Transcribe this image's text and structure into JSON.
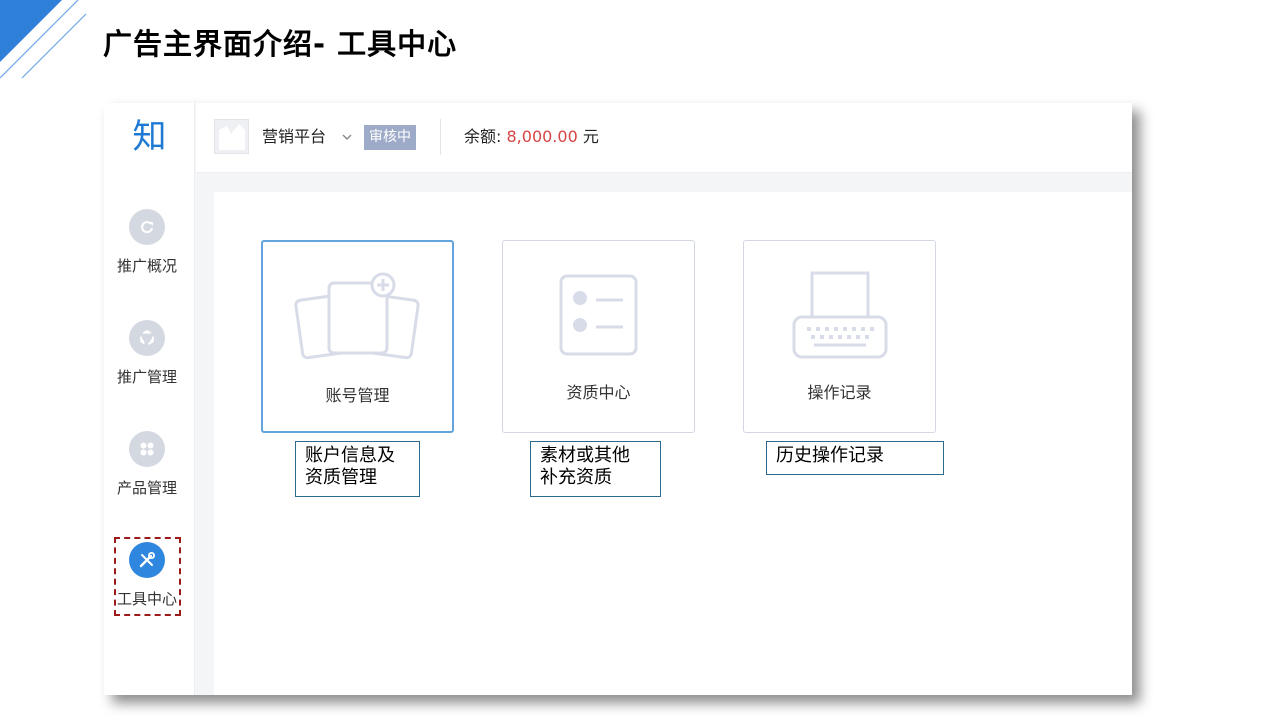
{
  "slide": {
    "title": "广告主界面介绍- 工具中心"
  },
  "app": {
    "logo_text": "知",
    "platform_name": "营销平台",
    "status_badge": "审核中",
    "balance_label": "余额:",
    "balance_amount": "8,000.00",
    "balance_unit": "元"
  },
  "sidebar": {
    "items": [
      {
        "label": "推广概况",
        "icon": "refresh-circle-icon"
      },
      {
        "label": "推广管理",
        "icon": "cycle-icon"
      },
      {
        "label": "产品管理",
        "icon": "grid-icon"
      },
      {
        "label": "工具中心",
        "icon": "tools-icon",
        "active": true
      }
    ]
  },
  "cards": [
    {
      "label": "账号管理",
      "icon": "account-cards-icon",
      "active": true
    },
    {
      "label": "资质中心",
      "icon": "qualification-list-icon"
    },
    {
      "label": "操作记录",
      "icon": "typewriter-icon"
    }
  ],
  "notes": [
    {
      "lines": [
        "账户信息及",
        "资质管理"
      ]
    },
    {
      "lines": [
        "素材或其他",
        "补充资质"
      ]
    },
    {
      "lines": [
        "历史操作记录"
      ]
    }
  ],
  "colors": {
    "accent": "#2e86de",
    "balance": "#d64545",
    "badge": "#9eabc8",
    "highlight_border": "#9b1b1b",
    "corner_blue": "#2f80d8"
  }
}
